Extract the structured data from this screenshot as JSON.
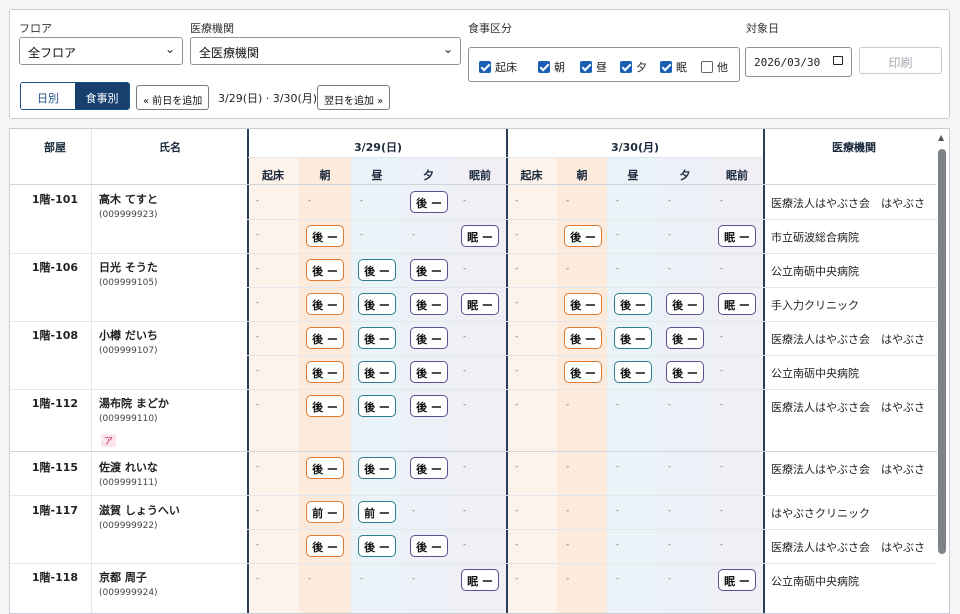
{
  "filters": {
    "floor_label": "フロア",
    "floor_value": "全フロア",
    "inst_label": "医療機関",
    "inst_value": "全医療機関",
    "meal_label": "食事区分",
    "meals": [
      {
        "label": "起床",
        "checked": true
      },
      {
        "label": "朝",
        "checked": true
      },
      {
        "label": "昼",
        "checked": true
      },
      {
        "label": "夕",
        "checked": true
      },
      {
        "label": "眠",
        "checked": true
      },
      {
        "label": "他",
        "checked": false
      }
    ],
    "date_label": "対象日",
    "date_value": "2026/03/30",
    "print_label": "印刷"
  },
  "toolbar": {
    "toggle_daily": "日別",
    "toggle_meal": "食事別",
    "prev_label": "« 前日を追加",
    "range_text": "3/29(日) · 3/30(月)",
    "next_label": "翌日を追加 »"
  },
  "table": {
    "headers": {
      "room": "部屋",
      "name": "氏名",
      "inst": "医療機関",
      "day1": "3/29(日)",
      "day2": "3/30(月)"
    },
    "subcols": [
      "起床",
      "朝",
      "昼",
      "夕",
      "眠前",
      "起床",
      "朝",
      "昼",
      "夕",
      "眠前"
    ],
    "residents": [
      {
        "room": "1階-101",
        "name": "高木 てすと",
        "id": "(009999923)"
      },
      {
        "room": "1階-106",
        "name": "日光 そうた",
        "id": "(009999105)"
      },
      {
        "room": "1階-108",
        "name": "小樽 だいち",
        "id": "(009999107)"
      },
      {
        "room": "1階-112",
        "name": "湯布院 まどか",
        "id": "(009999110)",
        "tag": "ア"
      },
      {
        "room": "1階-115",
        "name": "佐渡 れいな",
        "id": "(009999111)"
      },
      {
        "room": "1階-117",
        "name": "滋賀 しょうへい",
        "id": "(009999922)"
      },
      {
        "room": "1階-118",
        "name": "京都 周子",
        "id": "(009999924)"
      }
    ],
    "rows": [
      {
        "inst": "医療法人はやぶさ会　はやぶさ",
        "cells": [
          "-",
          "-",
          "-",
          "後 ー",
          "-",
          "-",
          "-",
          "-",
          "-",
          "-"
        ]
      },
      {
        "inst": "市立砺波総合病院",
        "cells": [
          "-",
          "後 ー",
          "-",
          "-",
          "眠 ー",
          "-",
          "後 ー",
          "-",
          "-",
          "眠 ー"
        ]
      },
      {
        "inst": "公立南砺中央病院",
        "cells": [
          "-",
          "後 ー",
          "後 ー",
          "後 ー",
          "-",
          "-",
          "-",
          "-",
          "-",
          "-"
        ]
      },
      {
        "inst": "手入力クリニック",
        "cells": [
          "-",
          "後 ー",
          "後 ー",
          "後 ー",
          "眠 ー",
          "-",
          "後 ー",
          "後 ー",
          "後 ー",
          "眠 ー"
        ]
      },
      {
        "inst": "医療法人はやぶさ会　はやぶさ",
        "cells": [
          "-",
          "後 ー",
          "後 ー",
          "後 ー",
          "-",
          "-",
          "後 ー",
          "後 ー",
          "後 ー",
          "-"
        ]
      },
      {
        "inst": "公立南砺中央病院",
        "cells": [
          "-",
          "後 ー",
          "後 ー",
          "後 ー",
          "-",
          "-",
          "後 ー",
          "後 ー",
          "後 ー",
          "-"
        ]
      },
      {
        "inst": "医療法人はやぶさ会　はやぶさ",
        "cells": [
          "-",
          "後 ー",
          "後 ー",
          "後 ー",
          "-",
          "-",
          "-",
          "-",
          "-",
          "-"
        ]
      },
      {
        "inst": "医療法人はやぶさ会　はやぶさ",
        "cells": [
          "-",
          "後 ー",
          "後 ー",
          "後 ー",
          "-",
          "-",
          "-",
          "-",
          "-",
          "-"
        ]
      },
      {
        "inst": "はやぶさクリニック",
        "cells": [
          "-",
          "前 ー",
          "前 ー",
          "-",
          "-",
          "-",
          "-",
          "-",
          "-",
          "-"
        ]
      },
      {
        "inst": "医療法人はやぶさ会　はやぶさ",
        "cells": [
          "-",
          "後 ー",
          "後 ー",
          "後 ー",
          "-",
          "-",
          "-",
          "-",
          "-",
          "-"
        ]
      },
      {
        "inst": "公立南砺中央病院",
        "cells": [
          "-",
          "-",
          "-",
          "-",
          "眠 ー",
          "-",
          "-",
          "-",
          "-",
          "眠 ー"
        ]
      }
    ]
  },
  "colors": {
    "accent": "#17406f",
    "orange": "#e07a2e",
    "teal": "#2b7c93",
    "purple": "#5b4f8e"
  }
}
